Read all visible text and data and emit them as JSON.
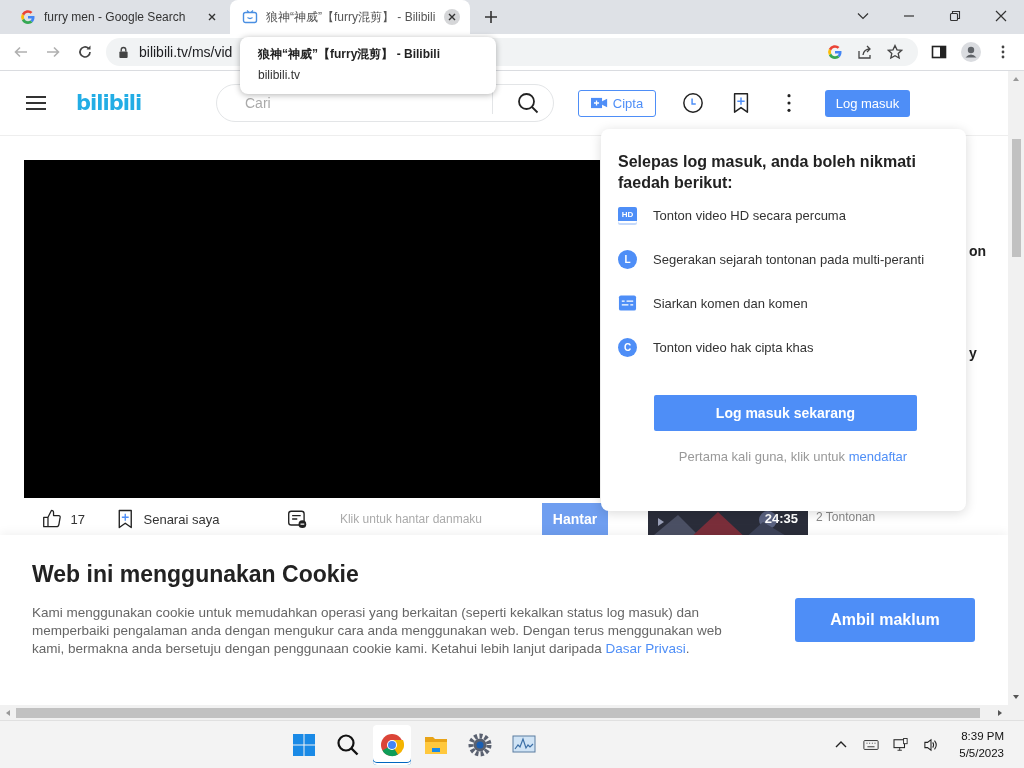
{
  "browser": {
    "tabs": [
      {
        "title": "furry men - Google Search",
        "kind": "google",
        "selected": false
      },
      {
        "title": "狼神“神威”【furry混剪】 - Bilibili",
        "kind": "site",
        "selected": true
      }
    ],
    "address": "bilibili.tv/ms/vid",
    "tooltip": {
      "title": "狼神“神威”【furry混剪】 - Bilibili",
      "domain": "bilibili.tv"
    }
  },
  "header": {
    "logo": "bilibili",
    "search_placeholder": "Cari",
    "create_button": "Cipta",
    "login_button": "Log masuk"
  },
  "video_actions": {
    "like_count": "17",
    "watchlist": "Senarai saya",
    "danmaku_placeholder": "Klik untuk hantar danmaku",
    "send_button": "Hantar"
  },
  "sidebar": {
    "title_fragments": [
      "on",
      "y"
    ],
    "thumbnail_duration": "24:35",
    "views": "2 Tontonan"
  },
  "login_popover": {
    "title": "Selepas log masuk, anda boleh nikmati faedah berikut:",
    "benefits": [
      {
        "kind": "screen",
        "badge": "HD",
        "text": "Tonton video HD secara percuma"
      },
      {
        "kind": "circle",
        "badge": "L",
        "text": "Segerakan sejarah tontonan pada multi-peranti"
      },
      {
        "kind": "comment",
        "text": "Siarkan komen dan komen"
      },
      {
        "kind": "circle",
        "badge": "C",
        "text": "Tonton video hak cipta khas"
      }
    ],
    "button": "Log masuk sekarang",
    "signup_prompt": "Pertama kali guna, klik untuk",
    "signup_link": "mendaftar"
  },
  "cookie_banner": {
    "title": "Web ini menggunakan Cookie",
    "body": "Kami menggunakan cookie untuk memudahkan operasi yang berkaitan (seperti kekalkan status log masuk) dan memperbaiki pengalaman anda dengan mengukur cara anda menggunakan web. Dengan terus menggunakan web kami, bermakna anda bersetuju dengan penggunaan cookie kami. Ketahui lebih lanjut daripada",
    "link": "Dasar Privasi",
    "end": ".",
    "button": "Ambil maklum"
  },
  "taskbar": {
    "time": "8:39 PM",
    "date": "5/5/2023"
  }
}
